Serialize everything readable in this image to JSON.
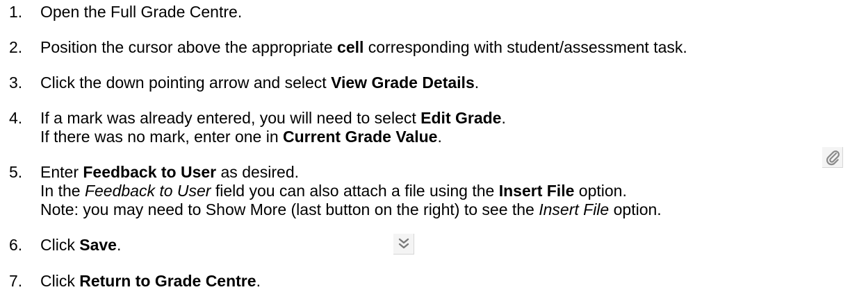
{
  "steps": [
    {
      "num": "1.",
      "parts": [
        "Open the Full Grade Centre."
      ]
    },
    {
      "num": "2.",
      "parts": [
        "Position the cursor above the appropriate ",
        "cell",
        " corresponding with student/assessment task."
      ]
    },
    {
      "num": "3.",
      "parts": [
        "Click the down pointing arrow and select ",
        "View Grade Details",
        "."
      ]
    },
    {
      "num": "4.",
      "parts": [
        "If a mark was already entered, you will need to select ",
        "Edit Grade",
        "."
      ],
      "line2": [
        "If there was no mark, enter one in ",
        "Current Grade Value",
        "."
      ]
    },
    {
      "num": "5.",
      "parts": [
        "Enter ",
        "Feedback to User",
        " as desired."
      ],
      "line2": [
        "In the ",
        "Feedback to User",
        " field you can also attach a file using the ",
        "Insert File",
        " option."
      ],
      "line3": [
        "Note: you may need to Show More (last button on the right) to see the ",
        "Insert File",
        " option."
      ]
    },
    {
      "num": "6.",
      "parts": [
        "Click ",
        "Save",
        "."
      ]
    },
    {
      "num": "7.",
      "parts": [
        "Click ",
        "Return to Grade Centre",
        "."
      ]
    }
  ],
  "icons": {
    "attach": "paperclip-icon",
    "show_more": "double-chevron-down-icon"
  }
}
